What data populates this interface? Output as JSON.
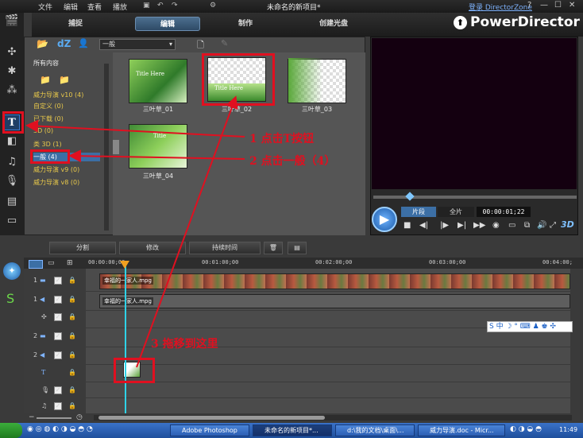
{
  "menu": [
    "文件",
    "编辑",
    "查看",
    "播放"
  ],
  "project_title": "未命名的新项目*",
  "login_link": "登录 DirectorZone",
  "window_controls": [
    "?",
    "—",
    "☐",
    "✕"
  ],
  "brand": "PowerDirector",
  "tabs": [
    "捕捉",
    "编辑",
    "制作",
    "创建光盘"
  ],
  "active_tab": "编辑",
  "library": {
    "filter_value": "一般",
    "tree_root": "所有内容",
    "tree_items": [
      "威力导演 v10 (4)",
      "自定义 (0)",
      "已下载 (0)",
      "3D (0)",
      "类 3D (1)",
      "一般 (4)",
      "威力导演 v9 (0)",
      "威力导演 v8 (0)"
    ],
    "thumbnails": [
      {
        "label": "三叶草_01",
        "caption": "Title Here"
      },
      {
        "label": "三叶草_02",
        "caption": "Title Here"
      },
      {
        "label": "三叶草_03",
        "caption": ""
      },
      {
        "label": "三叶草_04",
        "caption": "Title"
      }
    ]
  },
  "preview": {
    "mode_clip": "片段",
    "mode_movie": "全片",
    "timecode": "00:00:01;22",
    "badge_3d": "3D"
  },
  "edit_toolbar": [
    "分割",
    "修改",
    "持续时间"
  ],
  "timeline": {
    "ruler": [
      "00:00:00;00",
      "00:01:00;00",
      "00:02:00;00",
      "00:03:00;00",
      "00:04:00;"
    ],
    "tracks": [
      "1",
      "1",
      "",
      "2",
      "2",
      "",
      "",
      ""
    ],
    "video_clip_label": "幸福的一家人.mpg",
    "audio_clip_label": "幸福的一家人.mpg",
    "ime": "S 中 ☽ ° ⌨ ♟ ♚ ✣"
  },
  "annotations": {
    "step1": "1 点击T按钮",
    "step2": "2 点击一般（4）",
    "step3": "3 拖移到这里"
  },
  "taskbar": {
    "tasks": [
      "Adobe Photoshop",
      "未命名的新项目*...",
      "d:\\我的文档\\桌面\\...",
      "威力导演.doc - Micr..."
    ],
    "clock": "11:49"
  },
  "colors": {
    "annotation_red": "#e01020",
    "accent_blue": "#3c6fa5",
    "playhead": "#2fd3e8"
  }
}
